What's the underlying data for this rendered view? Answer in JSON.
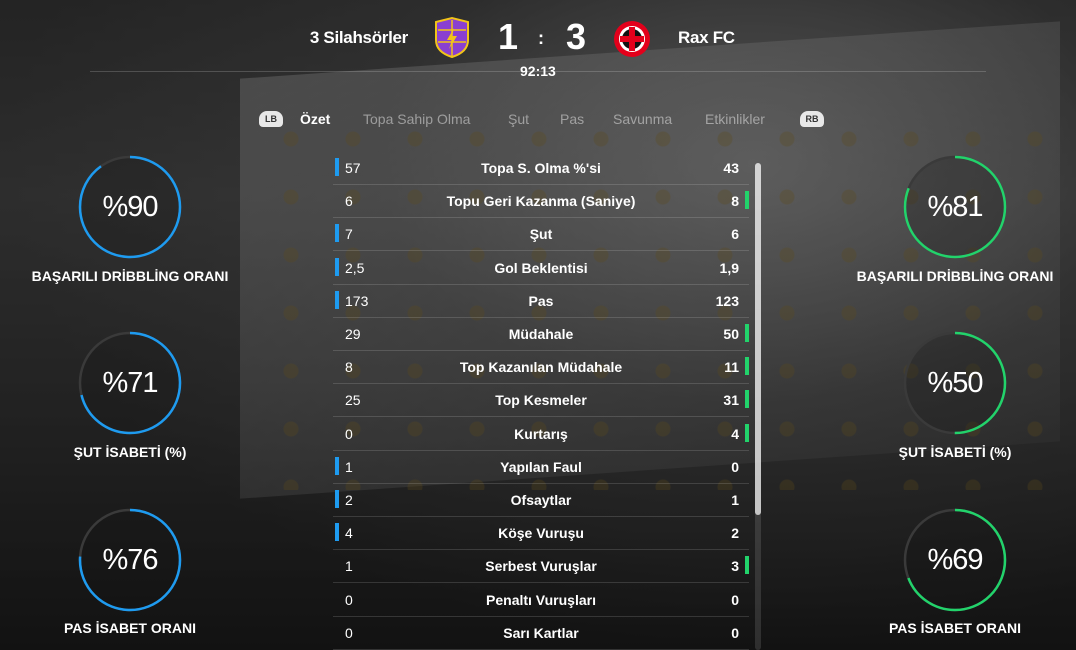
{
  "match": {
    "home_team": "3 Silahsörler",
    "away_team": "Rax FC",
    "home_score": "1",
    "away_score": "3",
    "separator": ":",
    "clock": "92:13"
  },
  "colors": {
    "home": "#1e9bf0",
    "away": "#22d36b",
    "ring_track": "#3a3a3a"
  },
  "tabs": {
    "left_shoulder": "LB",
    "right_shoulder": "RB",
    "items": [
      "Özet",
      "Topa Sahip Olma",
      "Şut",
      "Pas",
      "Savunma",
      "Etkinlikler"
    ],
    "active_index": 0
  },
  "home_gauges": [
    {
      "value": "%90",
      "percent": 90,
      "label": "BAŞARILI DRİBBLİNG ORANI"
    },
    {
      "value": "%71",
      "percent": 71,
      "label": "ŞUT İSABETİ (%)"
    },
    {
      "value": "%76",
      "percent": 76,
      "label": "PAS İSABET ORANI"
    }
  ],
  "away_gauges": [
    {
      "value": "%81",
      "percent": 81,
      "label": "BAŞARILI DRİBBLİNG ORANI"
    },
    {
      "value": "%50",
      "percent": 50,
      "label": "ŞUT İSABETİ (%)"
    },
    {
      "value": "%69",
      "percent": 69,
      "label": "PAS İSABET ORANI"
    }
  ],
  "stats": [
    {
      "home": "57",
      "label": "Topa S. Olma %'si",
      "away": "43",
      "leader": "home"
    },
    {
      "home": "6",
      "label": "Topu Geri Kazanma (Saniye)",
      "away": "8",
      "leader": "away"
    },
    {
      "home": "7",
      "label": "Şut",
      "away": "6",
      "leader": "home"
    },
    {
      "home": "2,5",
      "label": "Gol Beklentisi",
      "away": "1,9",
      "leader": "home"
    },
    {
      "home": "173",
      "label": "Pas",
      "away": "123",
      "leader": "home"
    },
    {
      "home": "29",
      "label": "Müdahale",
      "away": "50",
      "leader": "away"
    },
    {
      "home": "8",
      "label": "Top Kazanılan Müdahale",
      "away": "11",
      "leader": "away"
    },
    {
      "home": "25",
      "label": "Top Kesmeler",
      "away": "31",
      "leader": "away"
    },
    {
      "home": "0",
      "label": "Kurtarış",
      "away": "4",
      "leader": "away"
    },
    {
      "home": "1",
      "label": "Yapılan Faul",
      "away": "0",
      "leader": "home"
    },
    {
      "home": "2",
      "label": "Ofsaytlar",
      "away": "1",
      "leader": "home"
    },
    {
      "home": "4",
      "label": "Köşe Vuruşu",
      "away": "2",
      "leader": "home"
    },
    {
      "home": "1",
      "label": "Serbest Vuruşlar",
      "away": "3",
      "leader": "away"
    },
    {
      "home": "0",
      "label": "Penaltı Vuruşları",
      "away": "0",
      "leader": "none"
    },
    {
      "home": "0",
      "label": "Sarı Kartlar",
      "away": "0",
      "leader": "none"
    }
  ]
}
